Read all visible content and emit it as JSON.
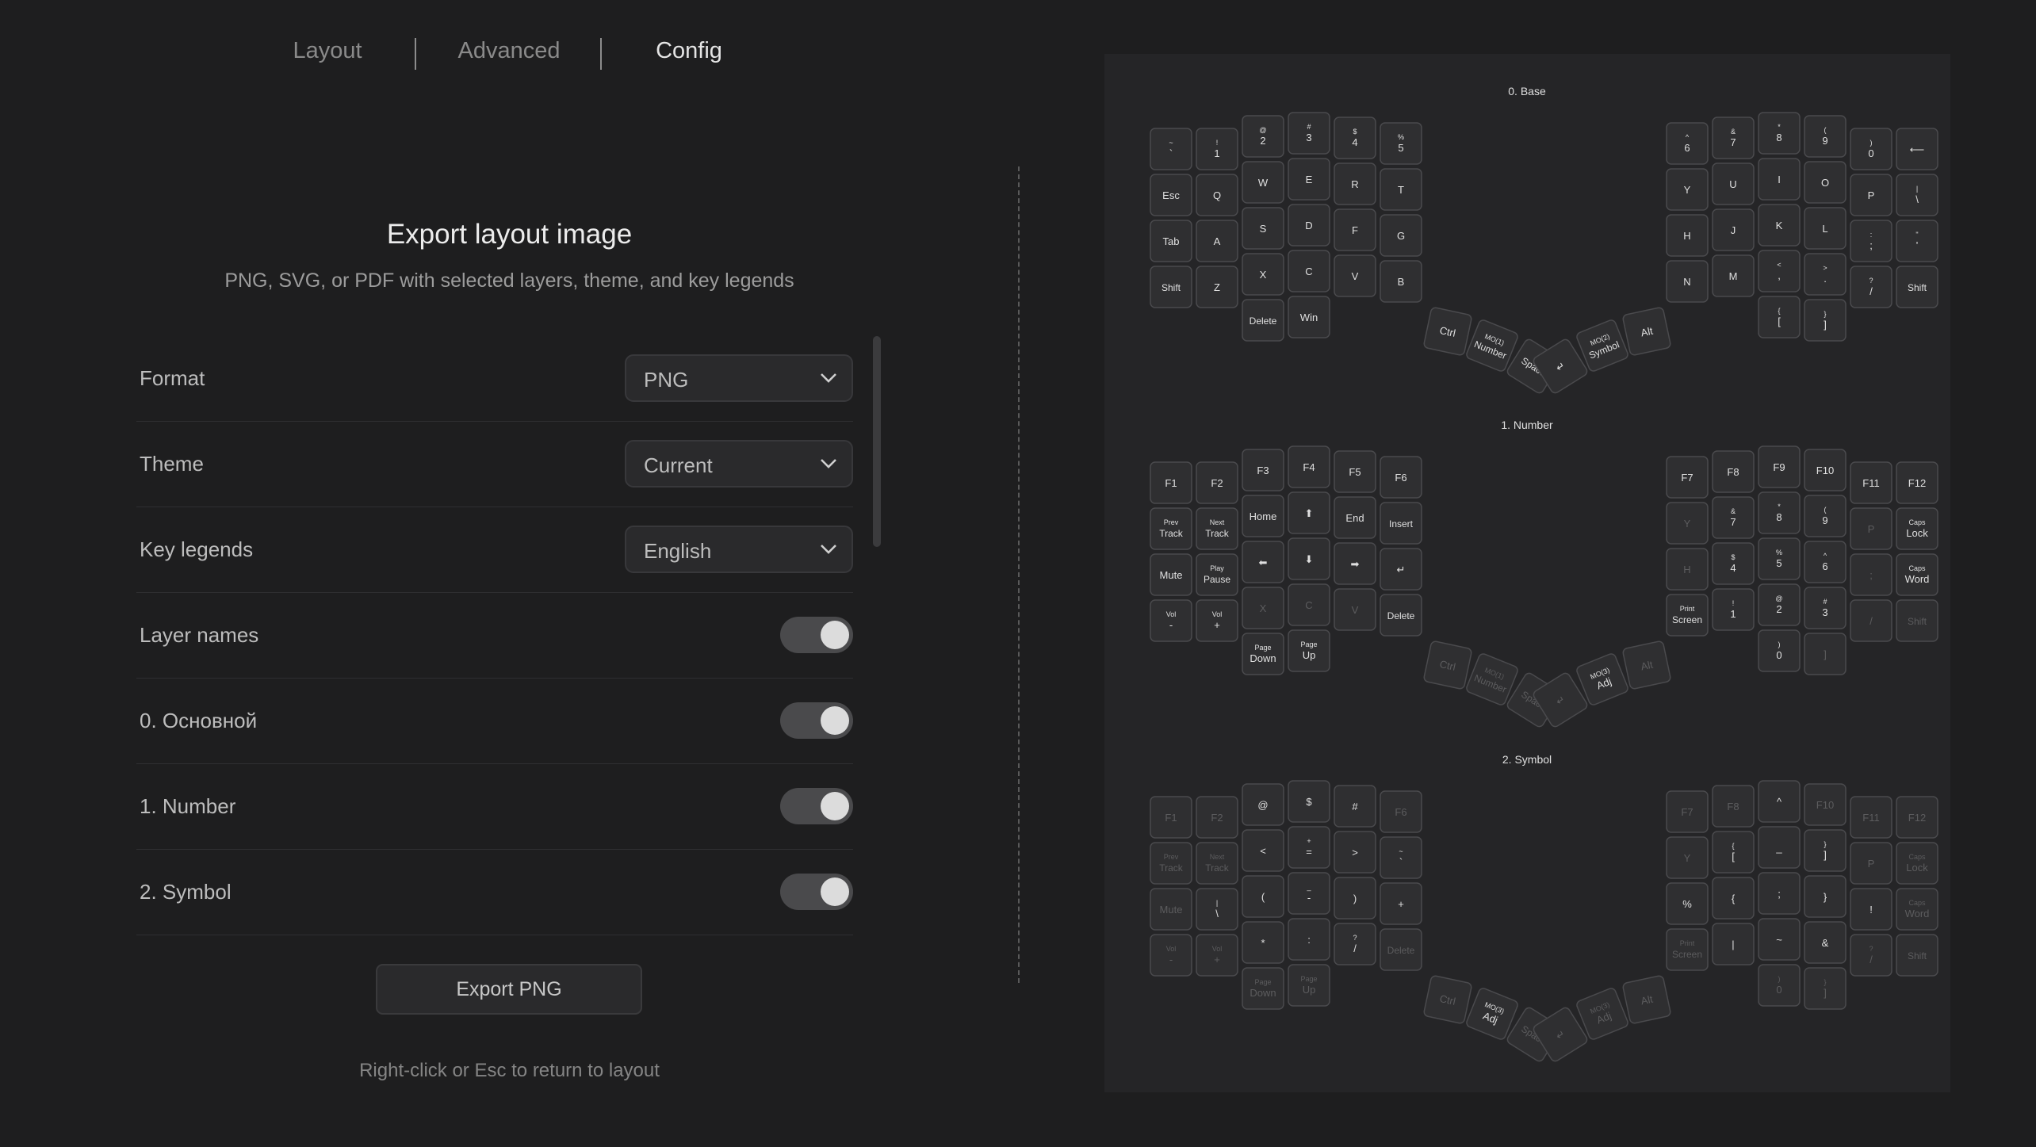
{
  "nav": {
    "tabs": [
      {
        "label": "Layout",
        "active": false
      },
      {
        "label": "Advanced",
        "active": false
      },
      {
        "label": "Config",
        "active": true
      }
    ]
  },
  "export": {
    "title": "Export layout image",
    "subtitle": "PNG, SVG, or PDF with selected layers, theme, and key legends",
    "format_label": "Format",
    "format_value": "PNG",
    "theme_label": "Theme",
    "theme_value": "Current",
    "legends_label": "Key legends",
    "legends_value": "English",
    "layer_names_label": "Layer names",
    "layer_names_on": true,
    "layers": [
      {
        "label": "0. Основной",
        "on": true
      },
      {
        "label": "1. Number",
        "on": true
      },
      {
        "label": "2. Symbol",
        "on": true
      }
    ],
    "button_label": "Export PNG",
    "hint": "Right-click or Esc to return to layout"
  },
  "colors": {
    "background": "#1e1e1f",
    "preview_bg": "#252527",
    "key_fill": "#2f2f31",
    "key_stroke": "#4a4a4d",
    "key_text": "#e0e0e0",
    "key_dim_text": "#5c5c5e"
  },
  "preview": {
    "layers": [
      {
        "name": "0. Base",
        "keys": [
          {
            "s": "~",
            "m": "`"
          },
          {
            "s": "!",
            "m": "1"
          },
          {
            "s": "@",
            "m": "2"
          },
          {
            "s": "#",
            "m": "3"
          },
          {
            "s": "$",
            "m": "4"
          },
          {
            "s": "%",
            "m": "5"
          },
          {
            "m": "Esc"
          },
          {
            "m": "Q"
          },
          {
            "m": "W"
          },
          {
            "m": "E"
          },
          {
            "m": "R"
          },
          {
            "m": "T"
          },
          {
            "m": "Tab"
          },
          {
            "m": "A"
          },
          {
            "m": "S"
          },
          {
            "m": "D"
          },
          {
            "m": "F"
          },
          {
            "m": "G"
          },
          {
            "m": "Shift"
          },
          {
            "m": "Z"
          },
          {
            "m": "X"
          },
          {
            "m": "C"
          },
          {
            "m": "V"
          },
          {
            "m": "B"
          },
          {
            "m": "Delete"
          },
          {
            "m": "Win"
          },
          {
            "m": "Ctrl"
          },
          {
            "s": "MO(1)",
            "m": "Number"
          },
          {
            "m": "Space"
          },
          {
            "s": "^",
            "m": "6"
          },
          {
            "s": "&",
            "m": "7"
          },
          {
            "s": "*",
            "m": "8"
          },
          {
            "s": "(",
            "m": "9"
          },
          {
            "s": ")",
            "m": "0"
          },
          {
            "m": "⟵"
          },
          {
            "m": "Y"
          },
          {
            "m": "U"
          },
          {
            "m": "I"
          },
          {
            "m": "O"
          },
          {
            "m": "P"
          },
          {
            "s": "|",
            "m": "\\"
          },
          {
            "m": "H"
          },
          {
            "m": "J"
          },
          {
            "m": "K"
          },
          {
            "m": "L"
          },
          {
            "s": ":",
            "m": ";"
          },
          {
            "s": "\"",
            "m": "'"
          },
          {
            "m": "N"
          },
          {
            "m": "M"
          },
          {
            "s": "<",
            "m": ","
          },
          {
            "s": ">",
            "m": "."
          },
          {
            "s": "?",
            "m": "/"
          },
          {
            "m": "Shift"
          },
          {
            "s": "{",
            "m": "["
          },
          {
            "s": "}",
            "m": "]"
          },
          {
            "m": "Alt"
          },
          {
            "s": "MO(2)",
            "m": "Symbol"
          },
          {
            "m": "↵"
          }
        ]
      },
      {
        "name": "1. Number",
        "keys": [
          {
            "m": "F1"
          },
          {
            "m": "F2"
          },
          {
            "m": "F3"
          },
          {
            "m": "F4"
          },
          {
            "m": "F5"
          },
          {
            "m": "F6"
          },
          {
            "s": "Prev",
            "m": "Track"
          },
          {
            "s": "Next",
            "m": "Track"
          },
          {
            "m": "Home"
          },
          {
            "m": "⬆"
          },
          {
            "m": "End"
          },
          {
            "m": "Insert"
          },
          {
            "m": "Mute"
          },
          {
            "s": "Play",
            "m": "Pause"
          },
          {
            "m": "⬅"
          },
          {
            "m": "⬇"
          },
          {
            "m": "➡"
          },
          {
            "m": "↵"
          },
          {
            "s": "Vol",
            "m": "-"
          },
          {
            "s": "Vol",
            "m": "+"
          },
          {
            "m": "X",
            "d": 1
          },
          {
            "m": "C",
            "d": 1
          },
          {
            "m": "V",
            "d": 1
          },
          {
            "m": "Delete"
          },
          {
            "s": "Page",
            "m": "Down"
          },
          {
            "s": "Page",
            "m": "Up"
          },
          {
            "m": "Ctrl",
            "d": 1
          },
          {
            "s": "MO(1)",
            "m": "Number",
            "d": 1
          },
          {
            "m": "Space",
            "d": 1
          },
          {
            "m": "F7"
          },
          {
            "m": "F8"
          },
          {
            "m": "F9"
          },
          {
            "m": "F10"
          },
          {
            "m": "F11"
          },
          {
            "m": "F12"
          },
          {
            "m": "Y",
            "d": 1
          },
          {
            "s": "&",
            "m": "7"
          },
          {
            "s": "*",
            "m": "8"
          },
          {
            "s": "(",
            "m": "9"
          },
          {
            "m": "P",
            "d": 1
          },
          {
            "s": "Caps",
            "m": "Lock"
          },
          {
            "m": "H",
            "d": 1
          },
          {
            "s": "$",
            "m": "4"
          },
          {
            "s": "%",
            "m": "5"
          },
          {
            "s": "^",
            "m": "6"
          },
          {
            "m": ";",
            "d": 1
          },
          {
            "s": "Caps",
            "m": "Word"
          },
          {
            "s": "Print",
            "m": "Screen"
          },
          {
            "s": "!",
            "m": "1"
          },
          {
            "s": "@",
            "m": "2"
          },
          {
            "s": "#",
            "m": "3"
          },
          {
            "m": "/",
            "d": 1
          },
          {
            "m": "Shift",
            "d": 1
          },
          {
            "s": ")",
            "m": "0"
          },
          {
            "m": "]",
            "d": 1
          },
          {
            "m": "Alt",
            "d": 1
          },
          {
            "s": "MO(3)",
            "m": "Adj"
          },
          {
            "m": "↵",
            "d": 1
          }
        ]
      },
      {
        "name": "2. Symbol",
        "keys": [
          {
            "m": "F1",
            "d": 1
          },
          {
            "m": "F2",
            "d": 1
          },
          {
            "m": "@"
          },
          {
            "m": "$"
          },
          {
            "m": "#"
          },
          {
            "m": "F6",
            "d": 1
          },
          {
            "s": "Prev",
            "m": "Track",
            "d": 1
          },
          {
            "s": "Next",
            "m": "Track",
            "d": 1
          },
          {
            "m": "<"
          },
          {
            "s": "+",
            "m": "="
          },
          {
            "m": ">"
          },
          {
            "s": "~",
            "m": "`"
          },
          {
            "m": "Mute",
            "d": 1
          },
          {
            "s": "|",
            "m": "\\"
          },
          {
            "m": "("
          },
          {
            "s": "_",
            "m": "-"
          },
          {
            "m": ")"
          },
          {
            "m": "+"
          },
          {
            "s": "Vol",
            "m": "-",
            "d": 1
          },
          {
            "s": "Vol",
            "m": "+",
            "d": 1
          },
          {
            "m": "*"
          },
          {
            "m": ":"
          },
          {
            "s": "?",
            "m": "/"
          },
          {
            "m": "Delete",
            "d": 1
          },
          {
            "s": "Page",
            "m": "Down",
            "d": 1
          },
          {
            "s": "Page",
            "m": "Up",
            "d": 1
          },
          {
            "m": "Ctrl",
            "d": 1
          },
          {
            "s": "MO(3)",
            "m": "Adj"
          },
          {
            "m": "Space",
            "d": 1
          },
          {
            "m": "F7",
            "d": 1
          },
          {
            "m": "F8",
            "d": 1
          },
          {
            "m": "^"
          },
          {
            "m": "F10",
            "d": 1
          },
          {
            "m": "F11",
            "d": 1
          },
          {
            "m": "F12",
            "d": 1
          },
          {
            "m": "Y",
            "d": 1
          },
          {
            "s": "{",
            "m": "["
          },
          {
            "m": "_"
          },
          {
            "s": "}",
            "m": "]"
          },
          {
            "m": "P",
            "d": 1
          },
          {
            "s": "Caps",
            "m": "Lock",
            "d": 1
          },
          {
            "m": "%"
          },
          {
            "m": "{"
          },
          {
            "m": ";"
          },
          {
            "m": "}"
          },
          {
            "m": "!"
          },
          {
            "s": "Caps",
            "m": "Word",
            "d": 1
          },
          {
            "s": "Print",
            "m": "Screen",
            "d": 1
          },
          {
            "m": "|"
          },
          {
            "m": "~"
          },
          {
            "m": "&"
          },
          {
            "s": "?",
            "m": "/",
            "d": 1
          },
          {
            "m": "Shift",
            "d": 1
          },
          {
            "s": ")",
            "m": "0",
            "d": 1
          },
          {
            "s": "}",
            "m": "]",
            "d": 1
          },
          {
            "m": "Alt",
            "d": 1
          },
          {
            "s": "MO(3)",
            "m": "Adj",
            "d": 1
          },
          {
            "m": "↵",
            "d": 1
          }
        ]
      }
    ]
  }
}
